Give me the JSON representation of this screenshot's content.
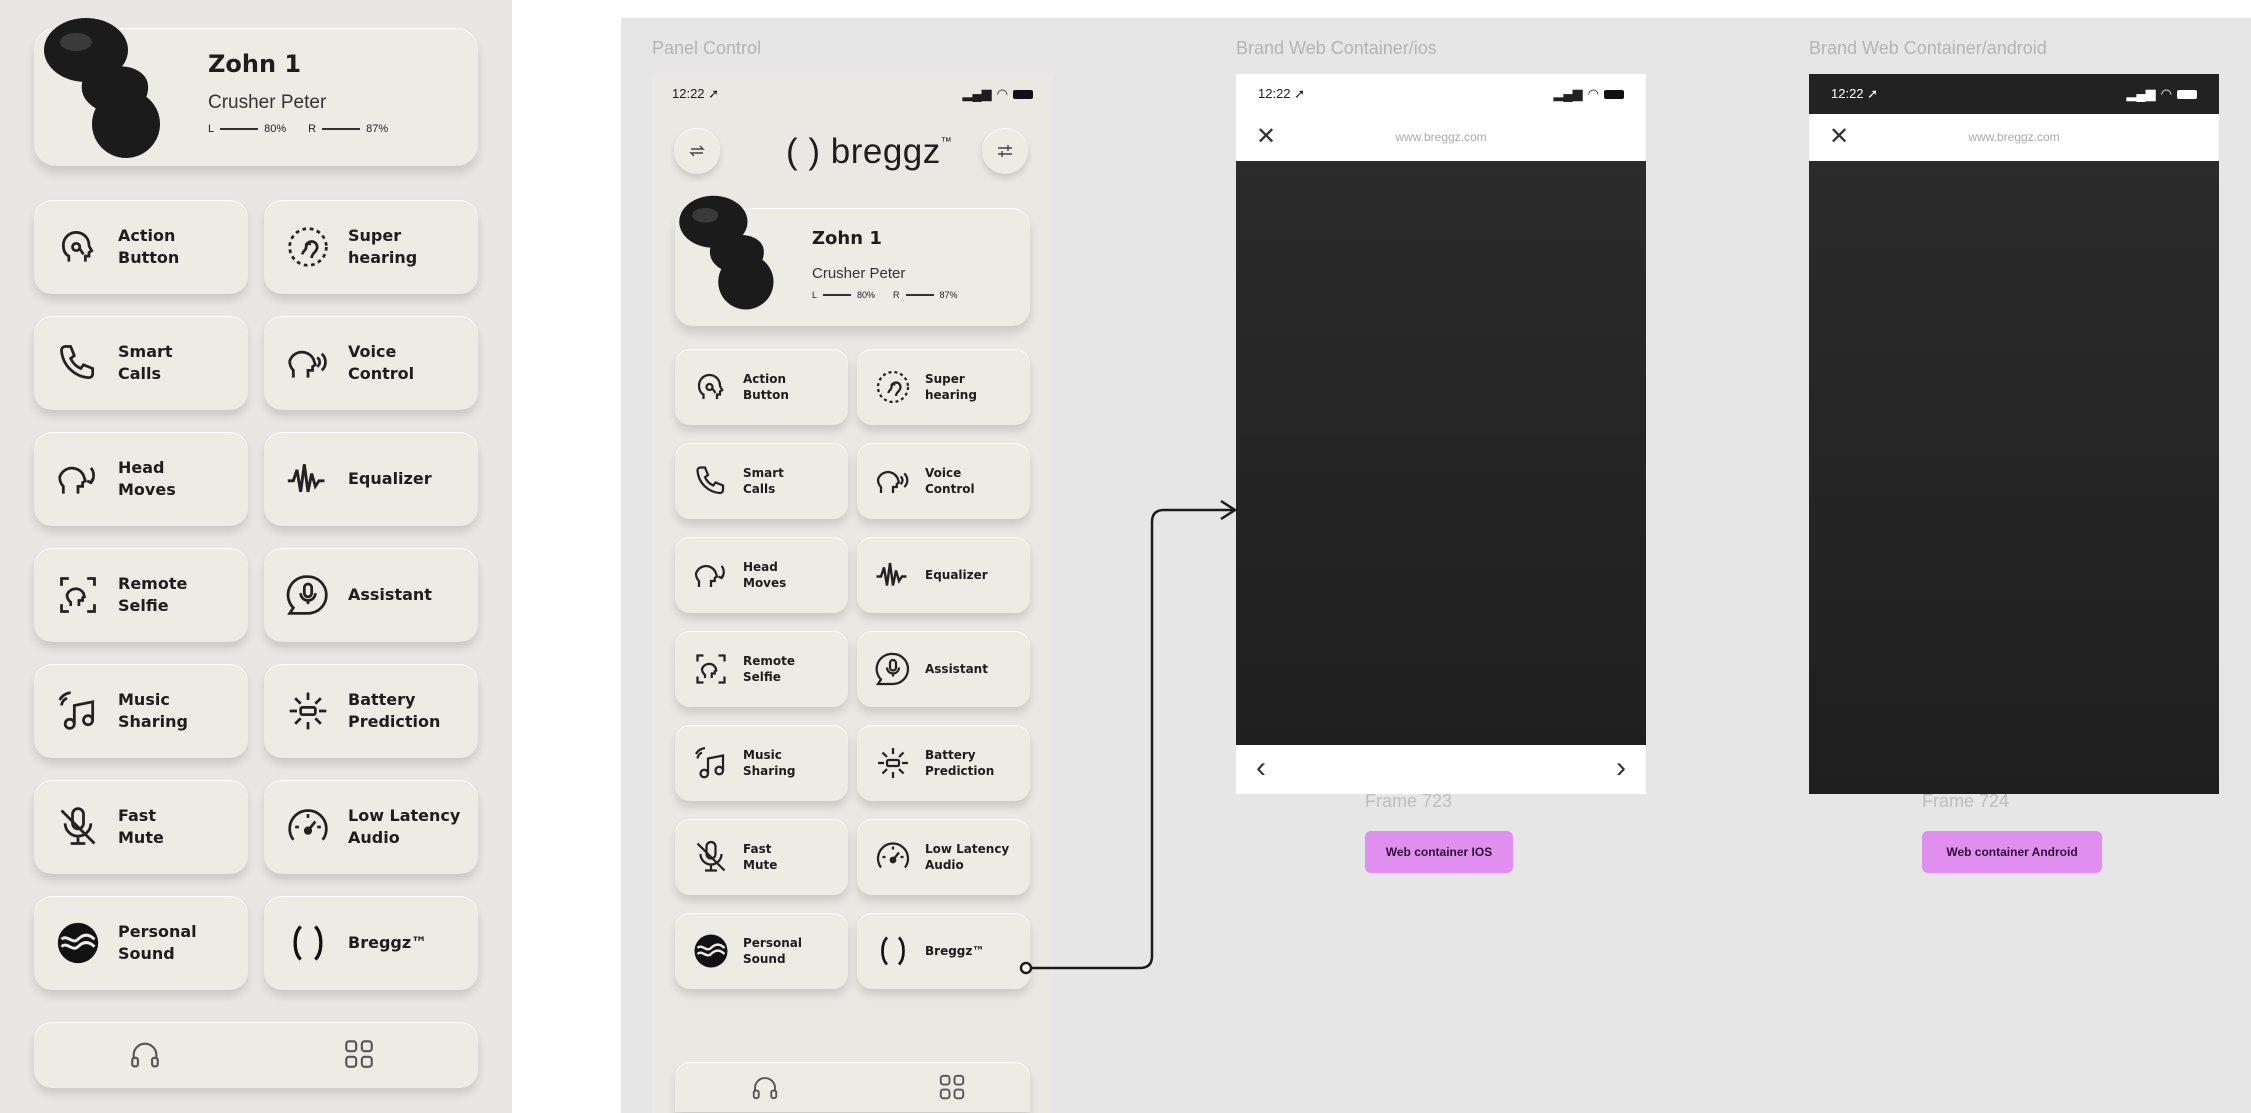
{
  "left_panel": {
    "device": {
      "name": "Zohn 1",
      "owner": "Crusher Peter",
      "left_label": "L",
      "left_value": "80%",
      "right_label": "R",
      "right_value": "87%"
    },
    "tiles": [
      {
        "key": "action",
        "line1": "Action",
        "line2": "Button",
        "icon": "head-touch-icon"
      },
      {
        "key": "super",
        "line1": "Super",
        "line2": "hearing",
        "icon": "ear-icon"
      },
      {
        "key": "calls",
        "line1": "Smart",
        "line2": "Calls",
        "icon": "phone-icon"
      },
      {
        "key": "voice",
        "line1": "Voice",
        "line2": "Control",
        "icon": "voice-control-icon"
      },
      {
        "key": "head",
        "line1": "Head",
        "line2": "Moves",
        "icon": "head-moves-icon"
      },
      {
        "key": "eq",
        "line1": "Equalizer",
        "line2": "",
        "icon": "equalizer-icon"
      },
      {
        "key": "selfie",
        "line1": "Remote",
        "line2": "Selfie",
        "icon": "remote-selfie-icon"
      },
      {
        "key": "assistant",
        "line1": "Assistant",
        "line2": "",
        "icon": "assistant-mic-icon"
      },
      {
        "key": "music",
        "line1": "Music",
        "line2": "Sharing",
        "icon": "music-sharing-icon"
      },
      {
        "key": "battery",
        "line1": "Battery",
        "line2": "Prediction",
        "icon": "battery-prediction-icon"
      },
      {
        "key": "mute",
        "line1": "Fast",
        "line2": "Mute",
        "icon": "mic-mute-icon"
      },
      {
        "key": "latency",
        "line1": "Low Latency",
        "line2": "Audio",
        "icon": "speedometer-icon"
      },
      {
        "key": "sound",
        "line1": "Personal",
        "line2": "Sound",
        "icon": "personal-sound-icon"
      },
      {
        "key": "breggz",
        "line1": "Breggz™",
        "line2": "",
        "icon": "breggz-logo-icon"
      }
    ],
    "nav": [
      {
        "icon": "headphones-icon"
      },
      {
        "icon": "grid-icon"
      }
    ]
  },
  "canvas": {
    "frame_labels": {
      "panel": "Panel Control",
      "ios": "Brand Web Container/ios",
      "android": "Brand Web Container/android"
    },
    "phone": {
      "time": "12:22",
      "brand": "( ) breggz",
      "brand_mark": "™",
      "device": {
        "name": "Zohn 1",
        "owner": "Crusher Peter",
        "left_label": "L",
        "left_value": "80%",
        "right_label": "R",
        "right_value": "87%"
      },
      "tiles": [
        {
          "line1": "Action",
          "line2": "Button"
        },
        {
          "line1": "Super",
          "line2": "hearing"
        },
        {
          "line1": "Smart",
          "line2": "Calls"
        },
        {
          "line1": "Voice",
          "line2": "Control"
        },
        {
          "line1": "Head",
          "line2": "Moves"
        },
        {
          "line1": "Equalizer",
          "line2": ""
        },
        {
          "line1": "Remote",
          "line2": "Selfie"
        },
        {
          "line1": "Assistant",
          "line2": ""
        },
        {
          "line1": "Music",
          "line2": "Sharing"
        },
        {
          "line1": "Battery",
          "line2": "Prediction"
        },
        {
          "line1": "Fast",
          "line2": "Mute"
        },
        {
          "line1": "Low Latency",
          "line2": "Audio"
        },
        {
          "line1": "Personal",
          "line2": "Sound"
        },
        {
          "line1": "Breggz™",
          "line2": ""
        }
      ]
    },
    "ios": {
      "time": "12:22",
      "close": "✕",
      "url": "www.breggz.com",
      "prev": "‹",
      "next": "›",
      "frame_name": "Frame 723",
      "tag": "Web container IOS"
    },
    "android": {
      "time": "12:22",
      "close": "✕",
      "url": "www.breggz.com",
      "frame_name": "Frame 724",
      "tag": "Web container Android"
    }
  },
  "colors": {
    "panel_bg": "#e9e7e3",
    "tile_bg": "#ecebe4",
    "canvas_bg": "#e6e6e6",
    "tag_bg": "#e08ff0",
    "web_view": "#262626"
  }
}
